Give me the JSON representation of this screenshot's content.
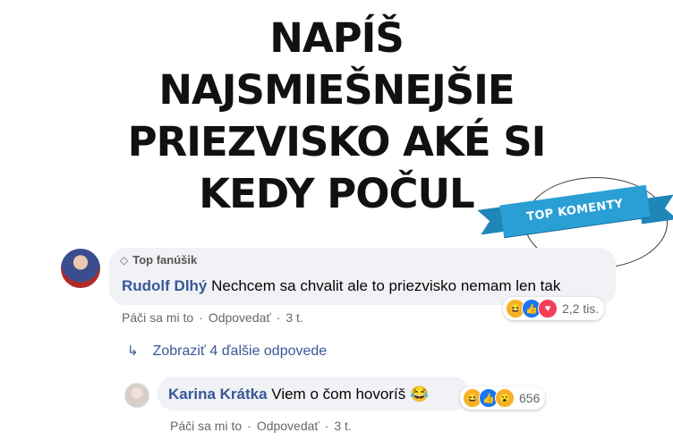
{
  "headline": {
    "line1": "NAPÍŠ",
    "line2": "NAJSMIEŠNEJŠIE",
    "line3": "PRIEZVISKO AKÉ SI",
    "line4": "KEDY POČUL"
  },
  "badge": {
    "label": "TOP KOMENTY",
    "color": "#2a9fd6"
  },
  "comment1": {
    "fan_label": "Top fanúšik",
    "author": "Rudolf Dlhý",
    "text": "Nechcem sa chvalit ale to priezvisko nemam len tak",
    "reactions": [
      "haha",
      "like",
      "love"
    ],
    "reaction_count": "2,2 tis.",
    "like_action": "Páči sa mi to",
    "reply_action": "Odpovedať",
    "time": "3 t."
  },
  "more_replies": {
    "label": "Zobraziť 4 ďalšie odpovede"
  },
  "comment2": {
    "author": "Karina Krátka",
    "text": "Viem o čom hovoríš",
    "emoji": "😂",
    "reactions": [
      "haha",
      "like",
      "wow"
    ],
    "reaction_count": "656",
    "like_action": "Páči sa mi to",
    "reply_action": "Odpovedať",
    "time": "3 t."
  },
  "colors": {
    "link": "#385898",
    "bubble": "#f0f2f5",
    "meta": "#65676b"
  }
}
